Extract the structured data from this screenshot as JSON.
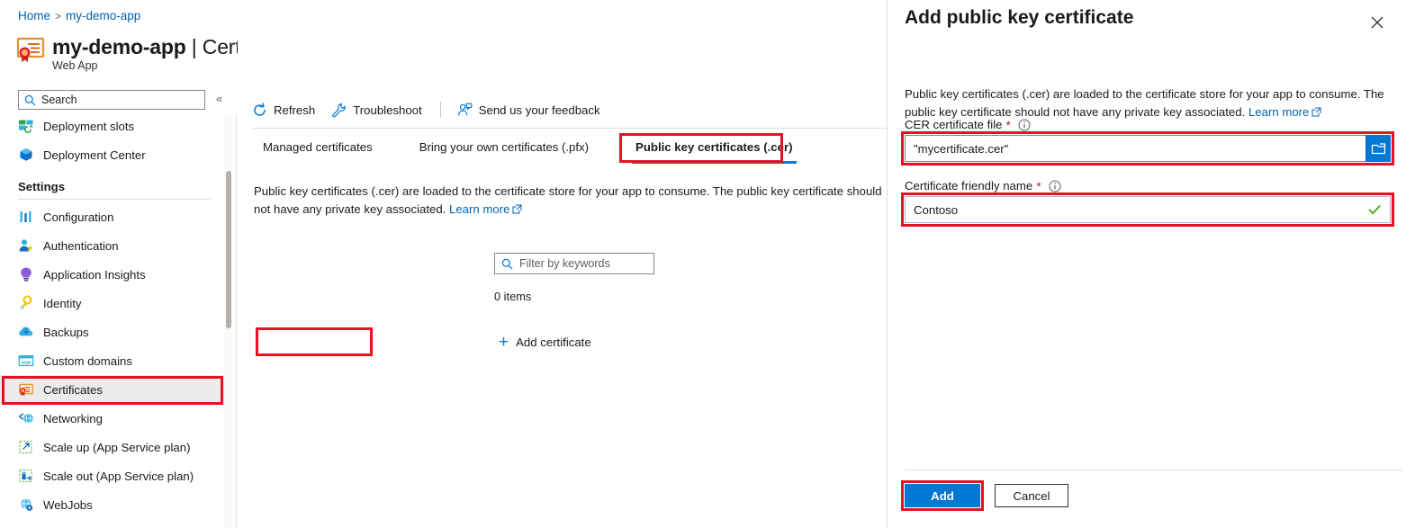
{
  "breadcrumb": {
    "home": "Home",
    "separator": ">",
    "current": "my-demo-app"
  },
  "header": {
    "resource_name": "my-demo-app",
    "separator": "|",
    "page_section": "Certificates",
    "subtitle": "Web App",
    "resource_icon": "certificate-icon",
    "favorite_icon": "star-icon",
    "more_icon": "ellipsis-icon"
  },
  "sidebar": {
    "search": {
      "placeholder": "Search",
      "icon": "search-icon"
    },
    "collapse_icon": "double-chevron-left-icon",
    "items": [
      {
        "label": "Deployment slots",
        "icon": "deployment-slots-icon",
        "selected": false,
        "type": "item"
      },
      {
        "label": "Deployment Center",
        "icon": "deployment-center-icon",
        "selected": false,
        "type": "item"
      },
      {
        "label": "Settings",
        "icon": "",
        "selected": false,
        "type": "section"
      },
      {
        "label": "Configuration",
        "icon": "configuration-icon",
        "selected": false,
        "type": "item"
      },
      {
        "label": "Authentication",
        "icon": "authentication-icon",
        "selected": false,
        "type": "item"
      },
      {
        "label": "Application Insights",
        "icon": "application-insights-icon",
        "selected": false,
        "type": "item"
      },
      {
        "label": "Identity",
        "icon": "identity-key-icon",
        "selected": false,
        "type": "item"
      },
      {
        "label": "Backups",
        "icon": "backups-cloud-icon",
        "selected": false,
        "type": "item"
      },
      {
        "label": "Custom domains",
        "icon": "custom-domains-icon",
        "selected": false,
        "type": "item"
      },
      {
        "label": "Certificates",
        "icon": "certificates-icon",
        "selected": true,
        "type": "item"
      },
      {
        "label": "Networking",
        "icon": "networking-icon",
        "selected": false,
        "type": "item"
      },
      {
        "label": "Scale up (App Service plan)",
        "icon": "scale-up-icon",
        "selected": false,
        "type": "item"
      },
      {
        "label": "Scale out (App Service plan)",
        "icon": "scale-out-icon",
        "selected": false,
        "type": "item"
      },
      {
        "label": "WebJobs",
        "icon": "webjobs-icon",
        "selected": false,
        "type": "item"
      }
    ]
  },
  "toolbar": {
    "refresh": {
      "label": "Refresh",
      "icon": "refresh-icon"
    },
    "troubleshoot": {
      "label": "Troubleshoot",
      "icon": "wrench-icon"
    },
    "feedback": {
      "label": "Send us your feedback",
      "icon": "feedback-person-icon"
    }
  },
  "tabs": [
    {
      "label": "Managed certificates",
      "active": false
    },
    {
      "label": "Bring your own certificates (.pfx)",
      "active": false
    },
    {
      "label": "Public key certificates (.cer)",
      "active": true
    }
  ],
  "main": {
    "description": "Public key certificates (.cer) are loaded to the certificate store for your app to consume. The public key certificate should not have any private key associated.",
    "learn_more": "Learn more",
    "filter": {
      "placeholder": "Filter by keywords",
      "icon": "search-icon"
    },
    "items_count": "0 items",
    "add_certificate": {
      "label": "Add certificate",
      "icon": "plus-icon"
    },
    "illustration_icon": "certificate-award-illustration"
  },
  "panel": {
    "title": "Add public key certificate",
    "close_icon": "close-icon",
    "description": "Public key certificates (.cer) are loaded to the certificate store for your app to consume. The public key certificate should not have any private key associated.",
    "learn_more": "Learn more",
    "fields": {
      "cer_file": {
        "label": "CER certificate file",
        "required_marker": "*",
        "info_icon": "info-icon",
        "value": "\"mycertificate.cer\"",
        "browse_icon": "folder-browse-icon"
      },
      "friendly_name": {
        "label": "Certificate friendly name",
        "required_marker": "*",
        "info_icon": "info-icon",
        "value": "Contoso",
        "valid_icon": "checkmark-icon"
      }
    },
    "actions": {
      "add": "Add",
      "cancel": "Cancel"
    }
  },
  "colors": {
    "accent_blue": "#0078d4",
    "link_blue": "#0063b1",
    "highlight_red": "#e81123",
    "required_red": "#a4262c",
    "valid_green": "#4caf22",
    "illustration_orange": "#f2a33c",
    "illustration_dark_orange": "#d95b0a",
    "illustration_red": "#c32a22"
  }
}
